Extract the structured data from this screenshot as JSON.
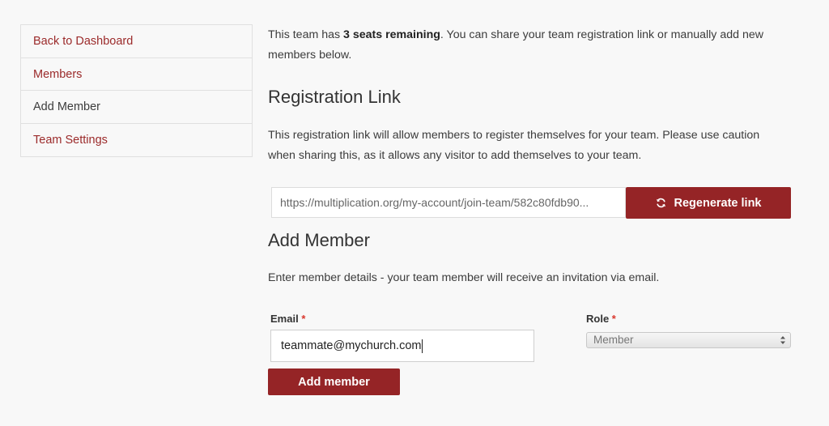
{
  "sidebar": {
    "items": [
      {
        "label": "Back to Dashboard"
      },
      {
        "label": "Members"
      },
      {
        "label": "Add Member"
      },
      {
        "label": "Team Settings"
      }
    ]
  },
  "intro": {
    "prefix": "This team has ",
    "seats": "3 seats remaining",
    "suffix": ". You can share your team registration link or manually add new members below."
  },
  "registration": {
    "heading": "Registration Link",
    "description": "This registration link will allow members to register themselves for your team. Please use caution when sharing this, as it allows any visitor to add themselves to your team.",
    "link_value": "https://multiplication.org/my-account/join-team/582c80fdb90...",
    "regenerate_label": "Regenerate link",
    "regenerate_icon": "refresh-icon"
  },
  "add_member": {
    "heading": "Add Member",
    "description": "Enter member details - your team member will receive an invitation via email.",
    "email_label": "Email",
    "email_value": "teammate@mychurch.com",
    "role_label": "Role",
    "role_value": "Member",
    "required_mark": "*",
    "submit_label": "Add member"
  },
  "colors": {
    "accent": "#952426",
    "link": "#9b2a2a",
    "required": "#d9372d"
  }
}
